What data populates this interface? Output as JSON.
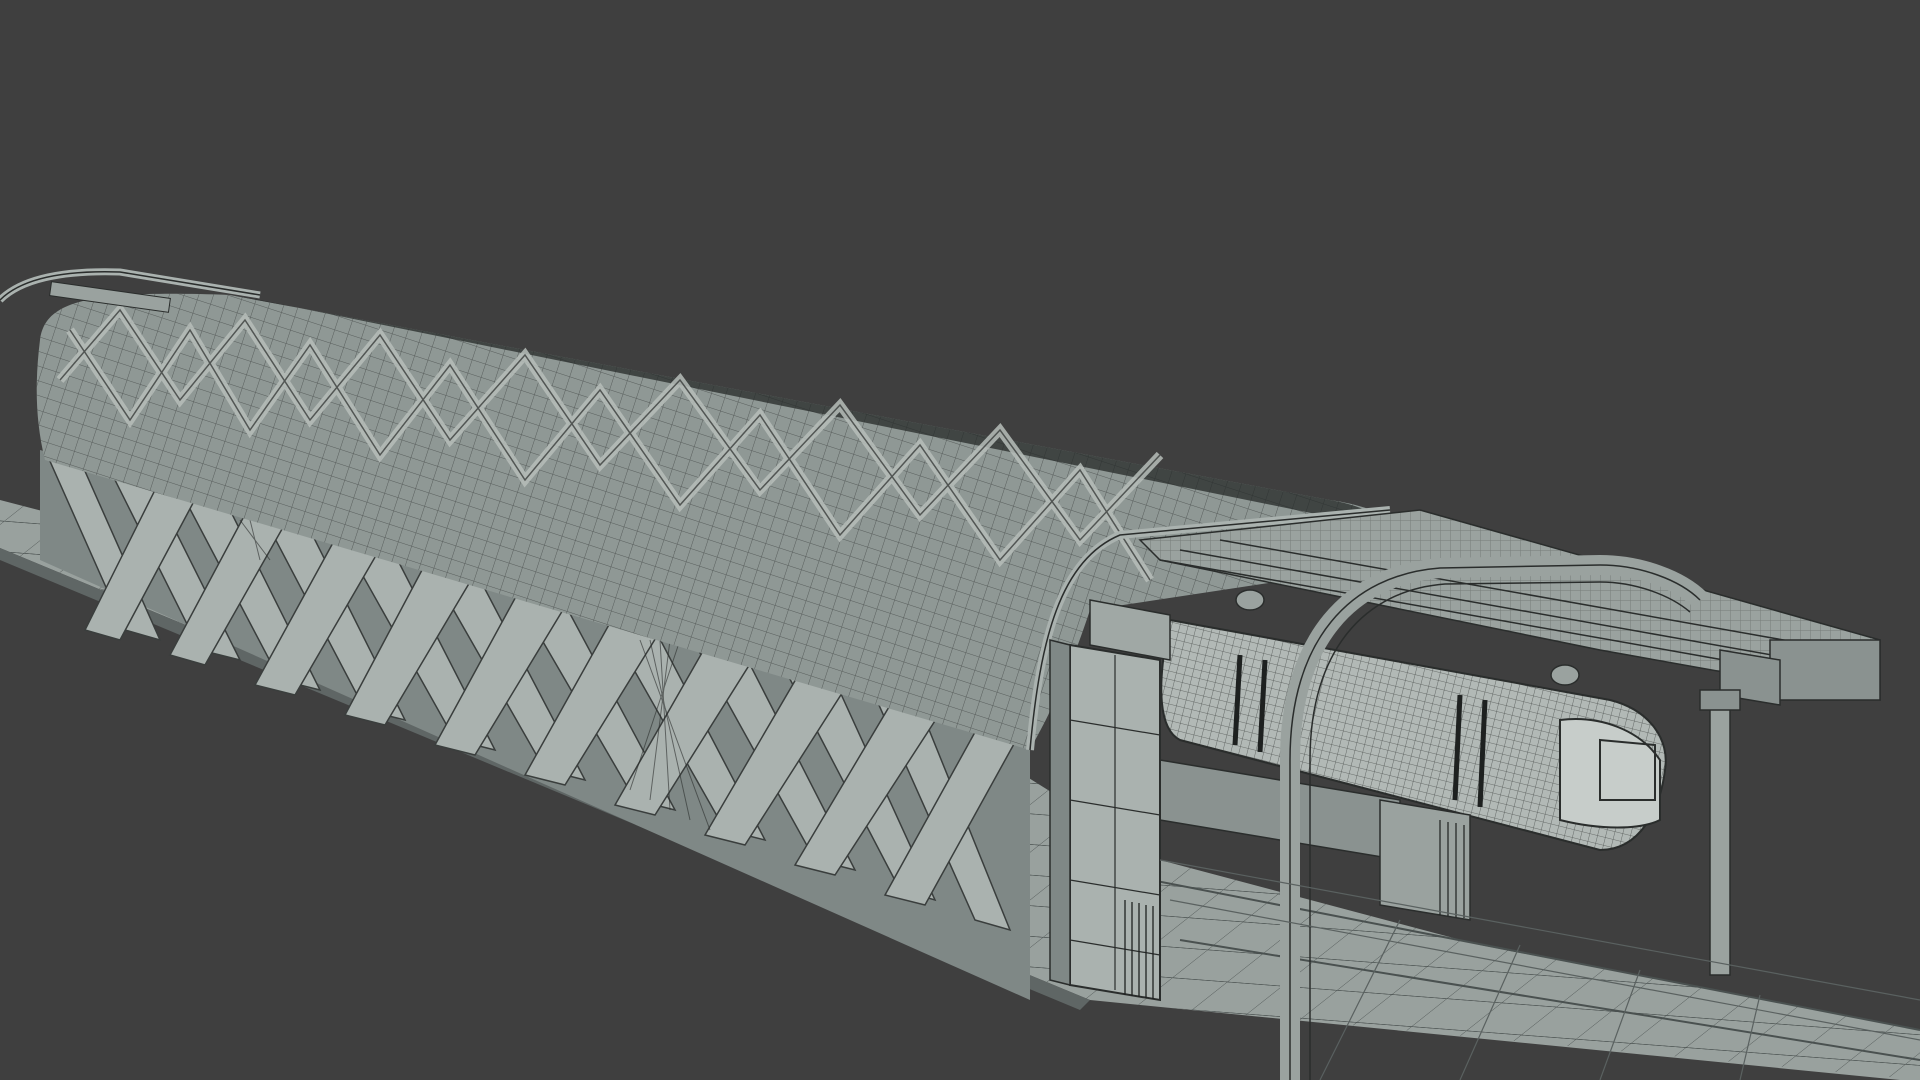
{
  "viewport": {
    "background_color": "#3f3f3f",
    "model_surface_color": "#8f9895",
    "model_light_color": "#a9b1ae",
    "model_dark_color": "#6f7775",
    "wire_color": "#2a2d2c",
    "view_mode": "wireframe-on-shaded",
    "subject_icon": "3d-station-model-icon"
  }
}
